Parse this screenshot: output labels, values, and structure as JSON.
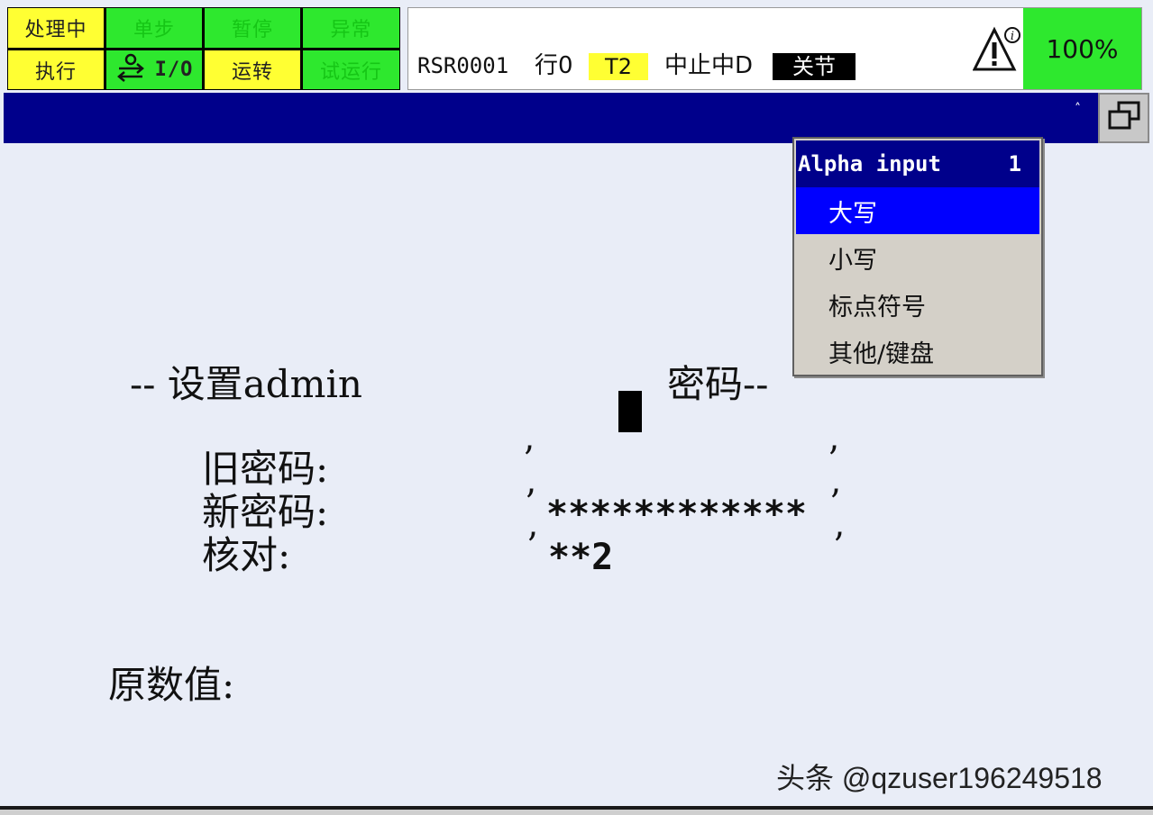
{
  "status_buttons": {
    "processing": "处理中",
    "step": "单步",
    "hold": "暂停",
    "fault": "异常",
    "execute": "执行",
    "io": "I/O",
    "run": "运转",
    "test_cycle": "试运行"
  },
  "status_bar": {
    "program": "RSR0001",
    "line": "行0",
    "mode": "T2",
    "state": "中止中D",
    "coord": "关节",
    "override": "100%"
  },
  "popup": {
    "title": "Alpha input",
    "number": "1",
    "items": [
      "大写",
      "小写",
      "标点符号",
      "其他/键盘"
    ],
    "selected_index": 0
  },
  "form": {
    "heading_left": "-- 设置admin",
    "heading_right": "密码--",
    "old_password_label": "旧密码:",
    "new_password_label": "新密码:",
    "confirm_label": "核对:",
    "new_password_value": "************",
    "confirm_value": "**2",
    "original_value_label": "原数值:"
  },
  "watermark": "头条 @qzuser196249518",
  "colors": {
    "yellow": "#ffff33",
    "green": "#2ee82e",
    "navy": "#00008b",
    "selection": "#0000ff",
    "background": "#e9edf7"
  },
  "icons": {
    "warning": "warning-triangle-icon",
    "io": "io-transfer-icon",
    "window": "window-toggle-icon"
  }
}
